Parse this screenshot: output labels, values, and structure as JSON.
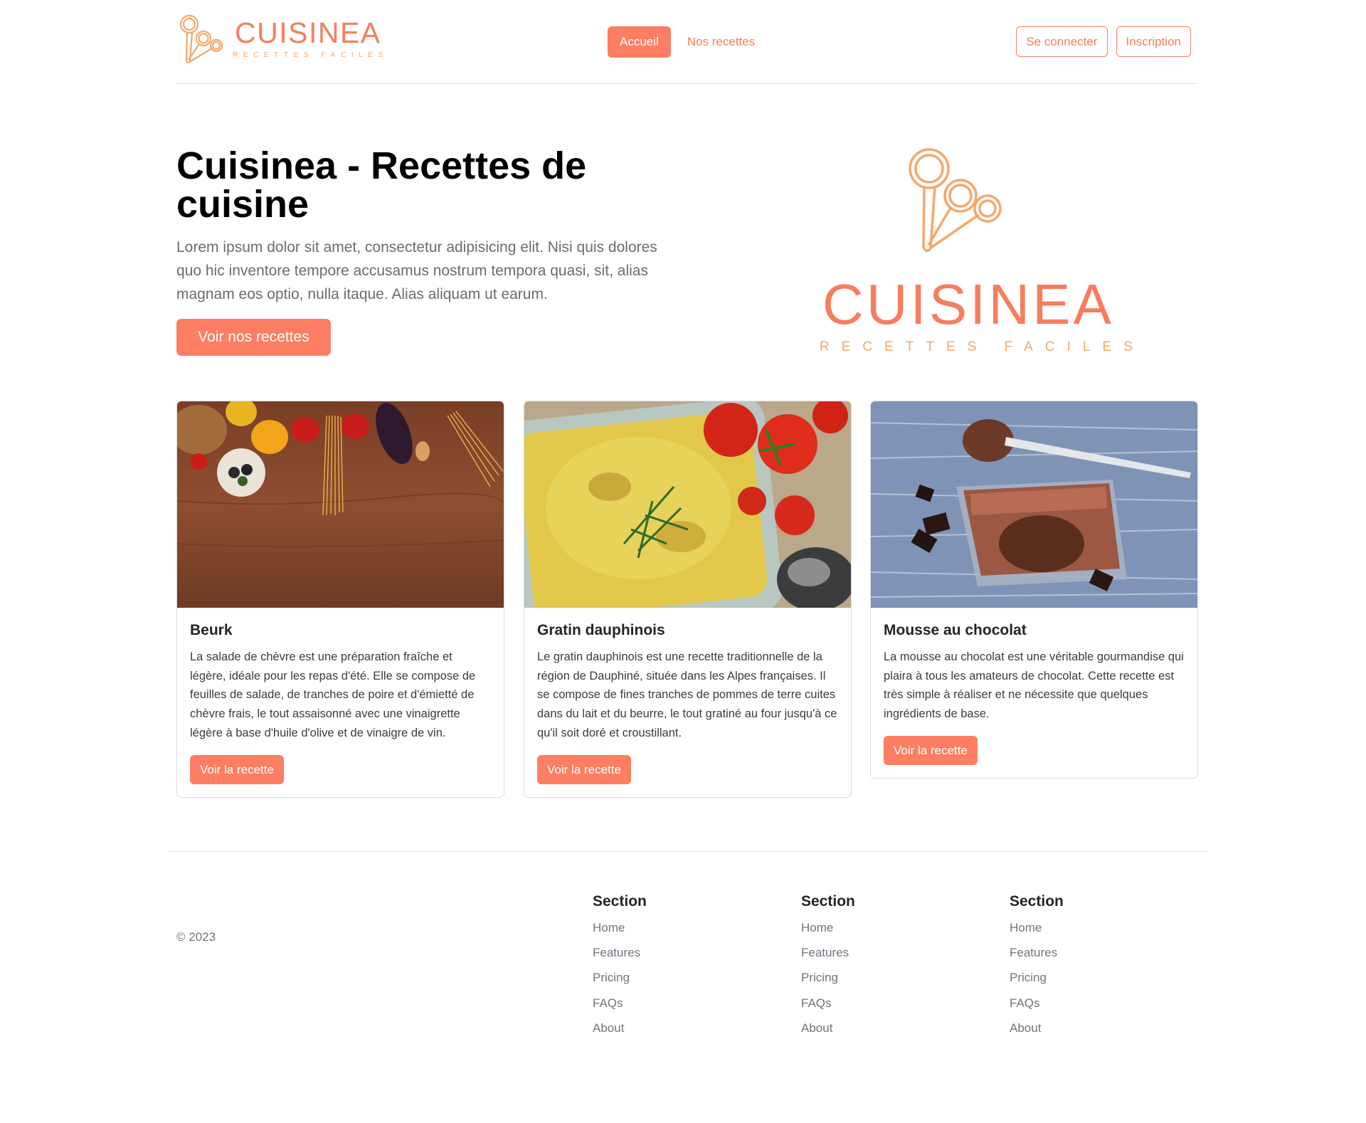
{
  "header": {
    "brand_name": "CUISINEA",
    "brand_tagline": "RECETTES FACILES",
    "nav": [
      {
        "label": "Accueil",
        "active": true
      },
      {
        "label": "Nos recettes",
        "active": false
      }
    ],
    "login_label": "Se connecter",
    "signup_label": "Inscription"
  },
  "hero": {
    "title": "Cuisinea - Recettes de cuisine",
    "text": "Lorem ipsum dolor sit amet, consectetur adipisicing elit. Nisi quis dolores quo hic inventore tempore accusamus nostrum tempora quasi, sit, alias magnam eos optio, nulla itaque. Alias aliquam ut earum.",
    "button_label": "Voir nos recettes",
    "logo_name": "CUISINEA",
    "logo_tagline": "RECETTES FACILES"
  },
  "recipes": [
    {
      "title": "Beurk",
      "text": "La salade de chèvre est une préparation fraîche et légère, idéale pour les repas d'été. Elle se compose de feuilles de salade, de tranches de poire et d'émietté de chèvre frais, le tout assaisonné avec une vinaigrette légère à base d'huile d'olive et de vinaigre de vin.",
      "button_label": "Voir la recette",
      "image": "vegetables-on-wooden-table"
    },
    {
      "title": "Gratin dauphinois",
      "text": "Le gratin dauphinois est une recette traditionnelle de la région de Dauphiné, située dans les Alpes françaises. Il se compose de fines tranches de pommes de terre cuites dans du lait et du beurre, le tout gratiné au four jusqu'à ce qu'il soit doré et croustillant.",
      "button_label": "Voir la recette",
      "image": "gratin-dish-with-tomatoes"
    },
    {
      "title": "Mousse au chocolat",
      "text": "La mousse au chocolat est une véritable gourmandise qui plaira à tous les amateurs de chocolat. Cette recette est très simple à réaliser et ne nécessite que quelques ingrédients de base.",
      "button_label": "Voir la recette",
      "image": "chocolate-mousse-in-glass"
    }
  ],
  "footer": {
    "copyright": "© 2023",
    "columns": [
      {
        "title": "Section",
        "links": [
          "Home",
          "Features",
          "Pricing",
          "FAQs",
          "About"
        ]
      },
      {
        "title": "Section",
        "links": [
          "Home",
          "Features",
          "Pricing",
          "FAQs",
          "About"
        ]
      },
      {
        "title": "Section",
        "links": [
          "Home",
          "Features",
          "Pricing",
          "FAQs",
          "About"
        ]
      }
    ]
  },
  "colors": {
    "accent": "#fd7e63",
    "brand_text": "#f77d5f",
    "brand_light": "#f4a86b"
  }
}
